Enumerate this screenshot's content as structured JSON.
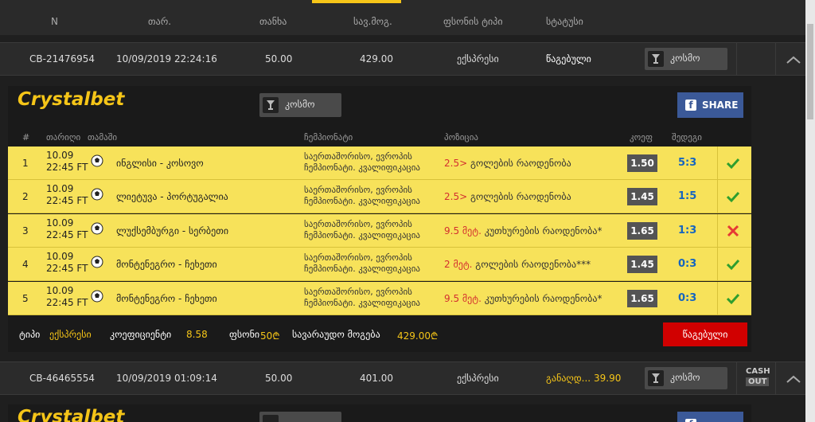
{
  "header": {
    "columns": [
      "N",
      "თარ.",
      "თანხა",
      "სავ.მოგ.",
      "ფსონის ტიპი",
      "სტატუსი"
    ]
  },
  "bets": [
    {
      "id": "CB-21476954",
      "date": "10/09/2019 22:24:16",
      "amount": "50.00",
      "potential": "429.00",
      "type": "ექსპრესი",
      "status": "წაგებული",
      "status_color": "#ffffff",
      "koso_label": "კოსმო"
    },
    {
      "id": "CB-46465554",
      "date": "10/09/2019 01:09:14",
      "amount": "50.00",
      "potential": "401.00",
      "type": "ექსპრესი",
      "status": "განაღდ...",
      "status_value": "39.90",
      "status_color": "#f5c518",
      "koso_label": "კოსმო",
      "cashout_top": "CASH",
      "cashout_bottom": "OUT"
    }
  ],
  "ticket": {
    "brand_a": "Crystal",
    "brand_b": "bet",
    "koso_label": "კოსმო",
    "share_label": "SHARE",
    "columns": {
      "num": "#",
      "date": "თარიღი",
      "match": "თამაში",
      "championship": "ჩემპიონატი",
      "position": "პოზიცია",
      "odd": "კოეფ",
      "result": "შედეგი"
    },
    "matches": [
      {
        "num": "1",
        "date": "10.09",
        "time": "22:45 FT",
        "match": "ინგლისი - კოსოვო",
        "champ1": "საერთაშორისო, ევროპის",
        "champ2": "ჩემპიონატი. კვალიფიკაცია",
        "pos_red": "2.5>",
        "pos_text": " გოლების რაოდენობა",
        "odd": "1.50",
        "score": "5:3",
        "won": true
      },
      {
        "num": "2",
        "date": "10.09",
        "time": "22:45 FT",
        "match": "ლიეტუვა - პორტუგალია",
        "champ1": "საერთაშორისო, ევროპის",
        "champ2": "ჩემპიონატი. კვალიფიკაცია",
        "pos_red": "2.5>",
        "pos_text": " გოლების რაოდენობა",
        "odd": "1.45",
        "score": "1:5",
        "won": true
      },
      {
        "num": "3",
        "date": "10.09",
        "time": "22:45 FT",
        "match": "ლუქსემბურგი - სერბეთი",
        "champ1": "საერთაშორისო, ევროპის",
        "champ2": "ჩემპიონატი. კვალიფიკაცია",
        "pos_red": "9.5 მეტ.",
        "pos_text": " კუთხურების რაოდენობა*",
        "odd": "1.65",
        "score": "1:3",
        "won": false
      },
      {
        "num": "4",
        "date": "10.09",
        "time": "22:45 FT",
        "match": "მონტენეგრო - ჩეხეთი",
        "champ1": "საერთაშორისო, ევროპის",
        "champ2": "ჩემპიონატი. კვალიფიკაცია",
        "pos_red": "2 მეტ.",
        "pos_text": " გოლების რაოდენობა***",
        "odd": "1.45",
        "score": "0:3",
        "won": true
      },
      {
        "num": "5",
        "date": "10.09",
        "time": "22:45 FT",
        "match": "მონტენეგრო - ჩეხეთი",
        "champ1": "საერთაშორისო, ევროპის",
        "champ2": "ჩემპიონატი. კვალიფიკაცია",
        "pos_red": "9.5 მეტ.",
        "pos_text": " კუთხურების რაოდენობა*",
        "odd": "1.65",
        "score": "0:3",
        "won": true
      }
    ],
    "summary": {
      "type_label": "ტიპი",
      "type_value": "ექსპრესი",
      "coef_label": "კოეფიციენტი",
      "coef_value": "8.58",
      "stake_label": "ფსონი",
      "stake_value": "50₾",
      "potential_label": "სავარაუდო მოგება",
      "potential_value": "429.00₾",
      "status_label": "წაგებული"
    }
  },
  "colors": {
    "accent": "#f5c518",
    "row_yellow": "#f7e25a",
    "lost_red": "#d10000",
    "win_green": "#2e9e2e",
    "loss_red": "#e53935",
    "facebook": "#3b5998"
  }
}
